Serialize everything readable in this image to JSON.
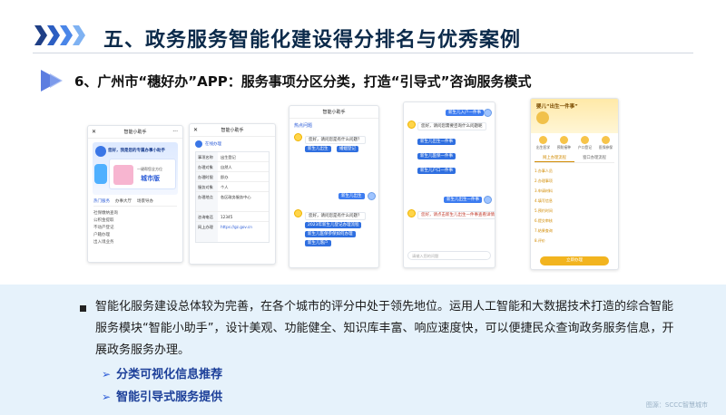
{
  "header": {
    "title": "五、政务服务智能化建设得分排名与优秀案例",
    "chevron_colors": [
      "#1f3f86",
      "#2c5ec2",
      "#4a86e8",
      "#7fb2f2"
    ]
  },
  "subheading": {
    "text": "6、广州市“穗好办”APP：服务事项分区分类，打造“引导式”咨询服务模式",
    "accent": "#5d7ee0"
  },
  "screenshots": {
    "s1": {
      "title": "智能小助手",
      "greeting": "您好，我是您的专属办事小助手",
      "city_label": "城市版",
      "card_line1": "一键帮您全方位",
      "tabs": [
        "热门服务",
        "办事大厅",
        "场景导办"
      ],
      "list_items": [
        "社保缴纳查询",
        "公积金提取",
        "不动产登记",
        "户籍办理",
        "出入境业务"
      ]
    },
    "s2": {
      "title": "智能小助手",
      "menu_label": "在线办理",
      "rows": [
        {
          "k": "事项名称",
          "v": "出生登记"
        },
        {
          "k": "办理对象",
          "v": "自然人"
        },
        {
          "k": "办理时限",
          "v": "即办"
        },
        {
          "k": "服务对象",
          "v": "个人"
        },
        {
          "k": "办理地点",
          "v": "各区政务服务中心"
        },
        {
          "k": "咨询电话",
          "v": "12345"
        },
        {
          "k": "网上办理",
          "v": "https://gz.gov.cn"
        }
      ]
    },
    "s3": {
      "title": "智能小助手",
      "hot_label": "热点问题",
      "q1": "您好，请问您是有什么问题？",
      "btn1": "新生儿出生",
      "btn2": "婚姻登记",
      "user_msg": "新生儿出生",
      "q2": "您好，请问您是有什么问题？",
      "opt1": "2023年新生儿登记办理流程",
      "opt2": "新生儿医保参保如何办理",
      "opt3": "新生儿落户"
    },
    "s4": {
      "user_q": "新生儿入户一件事",
      "reply": "您好，请问您需要咨询什么问题呢",
      "opt1": "新生儿出生一件事",
      "opt2": "新生儿医保一件事",
      "opt3": "新生儿户口一件事",
      "user_q2": "新生儿出生一件事",
      "final": "您好，请点击新生儿出生一件事查看详情",
      "input_ph": "请输入您的问题"
    },
    "s5": {
      "title": "婴儿“出生一件事”",
      "icons": [
        "出生医学",
        "预防接种",
        "户口登记",
        "医保参保",
        "社保卡"
      ],
      "tab_left": "网上办理流程",
      "tab_right": "窗口办理流程",
      "steps": [
        "1.办事人员",
        "2.办理事项",
        "3.申请材料",
        "4.填写信息",
        "5.预约时间",
        "6.提交审核",
        "7.结果查询",
        "8.评价"
      ],
      "button": "立即办理"
    }
  },
  "summary": {
    "paragraph": "智能化服务建设总体较为完善，在各个城市的评分中处于领先地位。运用人工智能和大数据技术打造的综合智能服务模块“智能小助手”，设计美观、功能健全、知识库丰富、响应速度快，可以便捷民众查询政务服务信息，开展政务服务办理。",
    "items": [
      "分类可视化信息推荐",
      "智能引导式服务提供"
    ],
    "watermark": "图源：SCCC智慧城市",
    "panel_color": "#e6f2fb",
    "item_color": "#1c3f99"
  }
}
